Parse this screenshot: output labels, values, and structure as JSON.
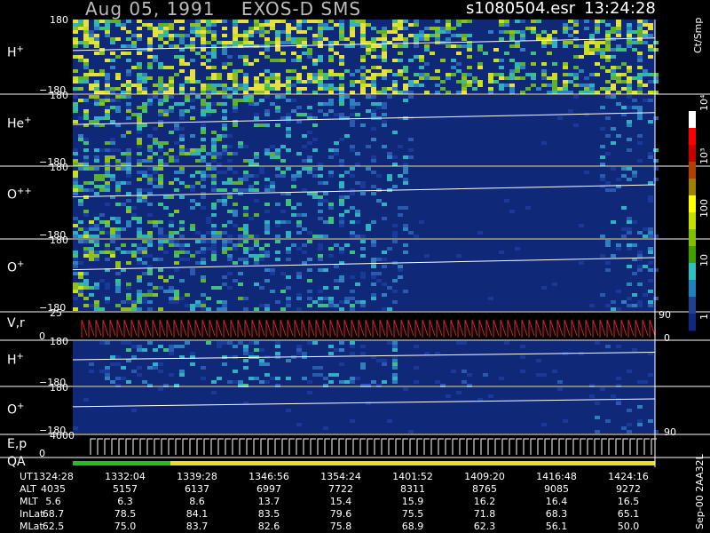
{
  "header": {
    "title": "Aug 05, 1991    EXOS-D SMS",
    "file": "s1080504.esr",
    "time": "13:24:28"
  },
  "panels": [
    {
      "label": "H",
      "sup": "+",
      "top": "180",
      "bot": "−180"
    },
    {
      "label": "He",
      "sup": "+",
      "top": "180",
      "bot": "−180"
    },
    {
      "label": "O",
      "sup": "++",
      "top": "180",
      "bot": "−180"
    },
    {
      "label": "O",
      "sup": "+",
      "top": "180",
      "bot": "−180"
    },
    {
      "label": "V,r",
      "sup": "",
      "top": "25",
      "bot": "0",
      "right_top": "90",
      "right_bot": "0"
    },
    {
      "label": "H",
      "sup": "+",
      "top": "180",
      "bot": "−180"
    },
    {
      "label": "O",
      "sup": "+",
      "top": "180",
      "bot": "−180",
      "right_bot": "90"
    },
    {
      "label": "E,p",
      "sup": "",
      "top": "4000",
      "bot": "0"
    },
    {
      "label": "QA",
      "sup": "",
      "top": "",
      "bot": ""
    }
  ],
  "colorbar": {
    "unit": "Ct/Smp",
    "ticks": [
      "10⁴",
      "10³",
      "100",
      "10",
      "1"
    ],
    "colors": [
      "#ffffff",
      "#ff0000",
      "#c80000",
      "#b04000",
      "#a08000",
      "#ffff00",
      "#c8e000",
      "#80c000",
      "#40a000",
      "#30c0c0",
      "#2080c0",
      "#204090",
      "#102880"
    ]
  },
  "footer": {
    "rows": [
      {
        "label": "UT",
        "values": [
          "1324:28",
          "1332:04",
          "1339:28",
          "1346:56",
          "1354:24",
          "1401:52",
          "1409:20",
          "1416:48",
          "1424:16"
        ]
      },
      {
        "label": "ALT",
        "values": [
          "4035",
          "5157",
          "6137",
          "6997",
          "7722",
          "8311",
          "8765",
          "9085",
          "9272"
        ]
      },
      {
        "label": "MLT",
        "values": [
          "5.6",
          "6.3",
          "8.6",
          "13.7",
          "15.4",
          "15.9",
          "16.2",
          "16.4",
          "16.5"
        ]
      },
      {
        "label": "InLat",
        "values": [
          "68.7",
          "78.5",
          "84.1",
          "83.5",
          "79.6",
          "75.5",
          "71.8",
          "68.3",
          "65.1"
        ]
      },
      {
        "label": "MLat",
        "values": [
          "62.5",
          "75.0",
          "83.7",
          "82.6",
          "75.8",
          "68.9",
          "62.3",
          "56.1",
          "50.0"
        ]
      }
    ]
  },
  "side_id": "Sep-00  2AA32L",
  "chart_data": {
    "type": "heatmap",
    "title": "Aug 05, 1991    EXOS-D SMS",
    "x": [
      "1324:28",
      "1332:04",
      "1339:28",
      "1346:56",
      "1354:24",
      "1401:52",
      "1409:20",
      "1416:48",
      "1424:16"
    ],
    "ylabel_panels": [
      "H+",
      "He+",
      "O++",
      "O+",
      "V,r",
      "H+",
      "O+",
      "E,p",
      "QA"
    ],
    "pitch_range": [
      -180,
      180
    ],
    "colorbar_ticks": [
      "1",
      "10",
      "100",
      "10³",
      "10⁴"
    ],
    "colorbar_unit": "Ct/Smp"
  }
}
